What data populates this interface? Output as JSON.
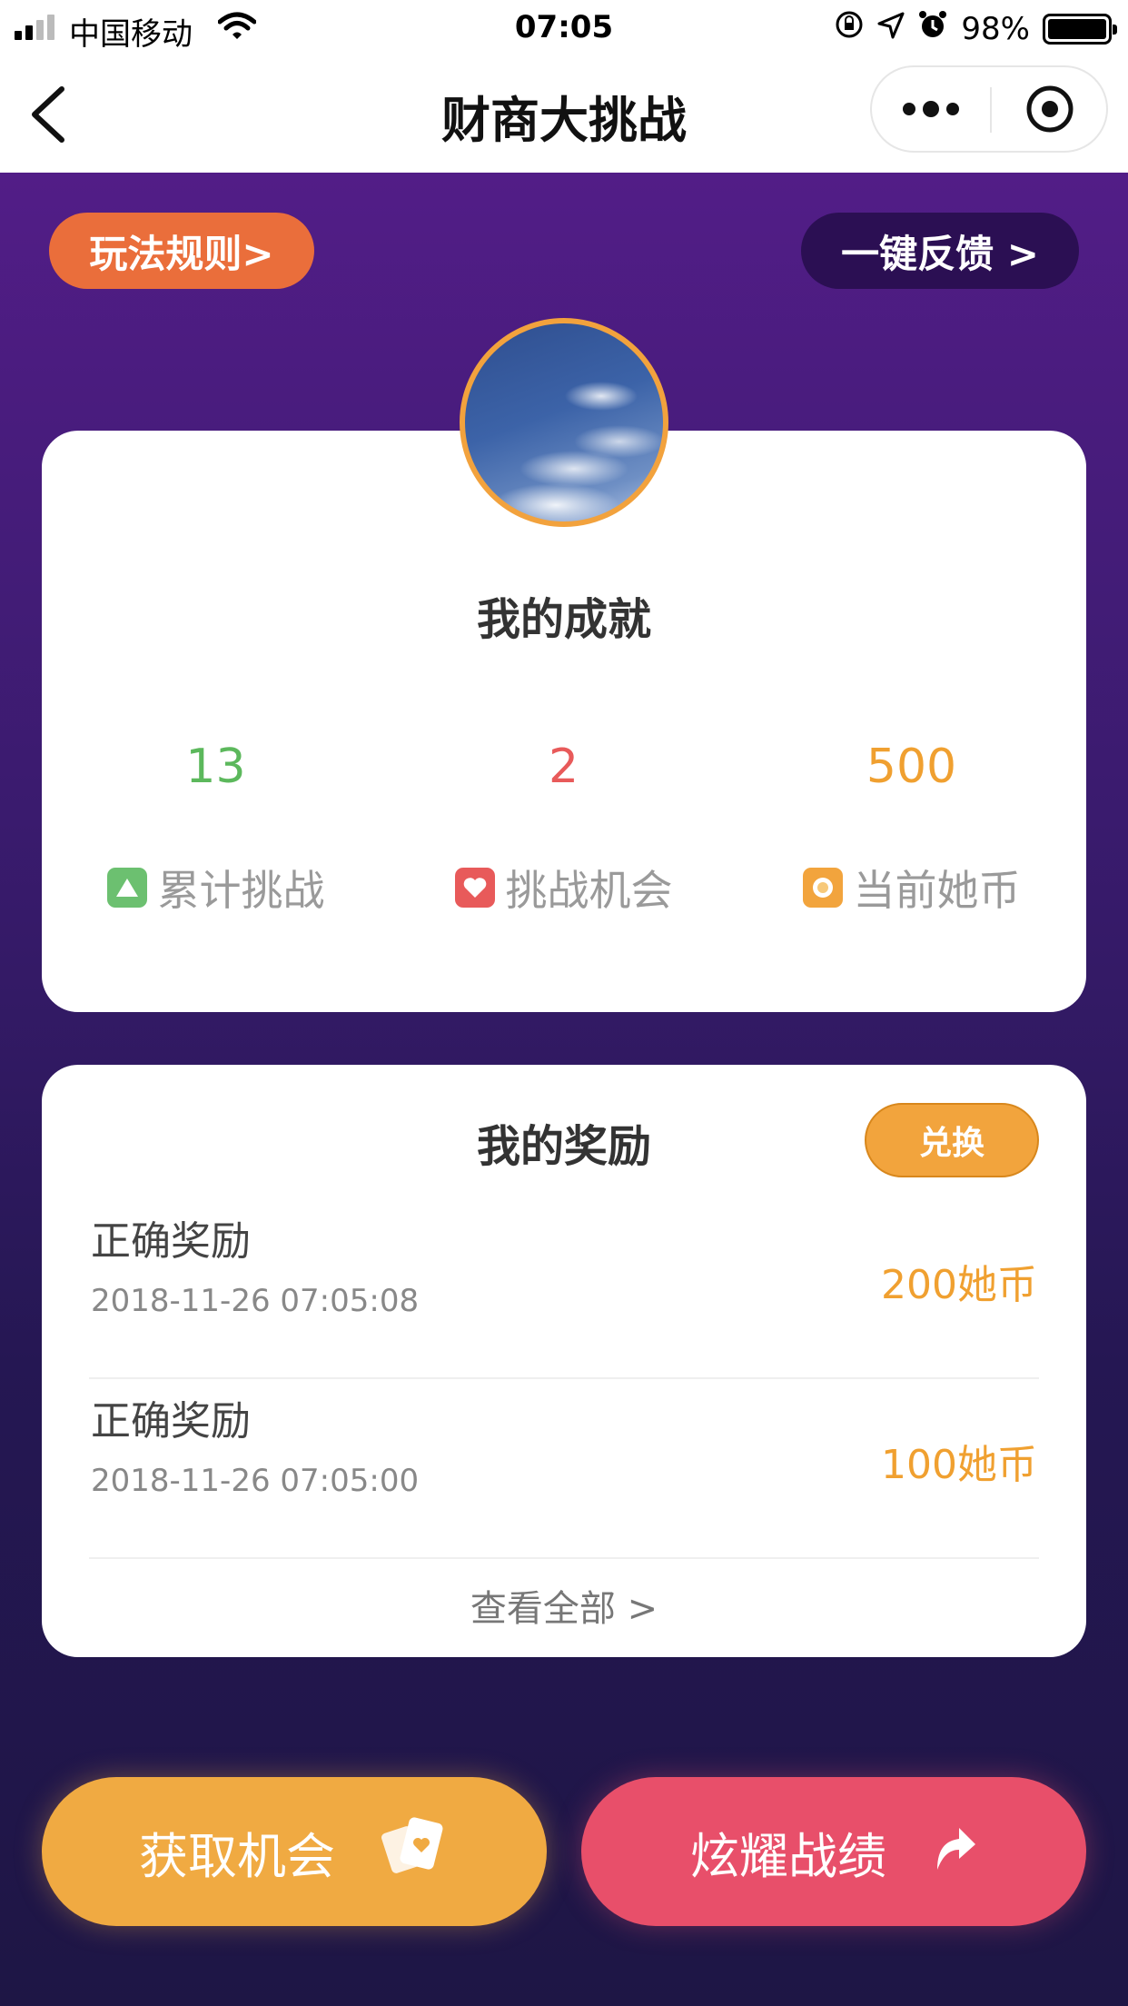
{
  "status_bar": {
    "carrier": "中国移动",
    "time": "07:05",
    "battery": "98%",
    "battery_level": 0.98
  },
  "nav": {
    "title": "财商大挑战"
  },
  "top_buttons": {
    "rules": "玩法规则>",
    "feedback": "一键反馈 >"
  },
  "achievements": {
    "title": "我的成就",
    "stats": [
      {
        "value": "13",
        "label": "累计挑战",
        "color": "#5cb85c",
        "icon": "triangle-icon"
      },
      {
        "value": "2",
        "label": "挑战机会",
        "color": "#e85a5a",
        "icon": "heart-icon"
      },
      {
        "value": "500",
        "label": "当前她币",
        "color": "#f0a030",
        "icon": "coin-icon"
      }
    ]
  },
  "rewards": {
    "title": "我的奖励",
    "exchange": "兑换",
    "items": [
      {
        "name": "正确奖励",
        "time": "2018-11-26 07:05:08",
        "amount": "200她币"
      },
      {
        "name": "正确奖励",
        "time": "2018-11-26 07:05:00",
        "amount": "100她币"
      }
    ],
    "view_all": "查看全部 >"
  },
  "actions": {
    "get_chance": "获取机会",
    "show_off": "炫耀战绩"
  },
  "colors": {
    "accent_orange": "#f0aa42",
    "accent_red": "#e84f6a",
    "rules_orange": "#ea6e3b",
    "bg_purple": "#521d87",
    "bg_deep": "#1e1645"
  }
}
